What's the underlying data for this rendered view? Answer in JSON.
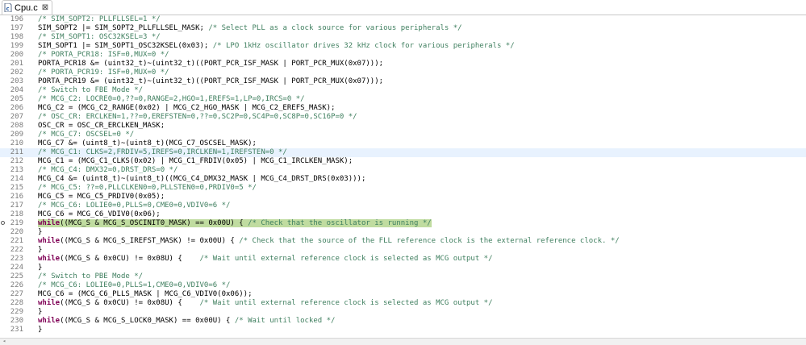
{
  "tab": {
    "title": "Cpu.c",
    "close": "⊠",
    "icon": "c-file-icon"
  },
  "lines": [
    {
      "n": "196",
      "parts": [
        {
          "t": "/* SIM_SOPT2: PLLFLLSEL=1 */",
          "s": "cm"
        }
      ]
    },
    {
      "n": "197",
      "parts": [
        {
          "t": "SIM_SOPT2 |= SIM_SOPT2_PLLFLLSEL_MASK; "
        },
        {
          "t": "/* Select PLL as a clock source for various peripherals */",
          "s": "cm"
        }
      ]
    },
    {
      "n": "198",
      "parts": [
        {
          "t": "/* SIM_SOPT1: OSC32KSEL=3 */",
          "s": "cm"
        }
      ]
    },
    {
      "n": "199",
      "parts": [
        {
          "t": "SIM_SOPT1 |= SIM_SOPT1_OSC32KSEL(0x03); "
        },
        {
          "t": "/* LPO 1kHz oscillator drives 32 kHz clock for various peripherals */",
          "s": "cm"
        }
      ]
    },
    {
      "n": "200",
      "parts": [
        {
          "t": "/* PORTA_PCR18: ISF=0,MUX=0 */",
          "s": "cm"
        }
      ]
    },
    {
      "n": "201",
      "parts": [
        {
          "t": "PORTA_PCR18 &= (uint32_t)~(uint32_t)((PORT_PCR_ISF_MASK | PORT_PCR_MUX(0x07)));"
        }
      ]
    },
    {
      "n": "202",
      "parts": [
        {
          "t": "/* PORTA_PCR19: ISF=0,MUX=0 */",
          "s": "cm"
        }
      ]
    },
    {
      "n": "203",
      "parts": [
        {
          "t": "PORTA_PCR19 &= (uint32_t)~(uint32_t)((PORT_PCR_ISF_MASK | PORT_PCR_MUX(0x07)));"
        }
      ]
    },
    {
      "n": "204",
      "parts": [
        {
          "t": "/* Switch to FBE Mode */",
          "s": "cm"
        }
      ]
    },
    {
      "n": "205",
      "parts": [
        {
          "t": "/* MCG_C2: LOCRE0=0,??=0,RANGE=2,HGO=1,EREFS=1,LP=0,IRCS=0 */",
          "s": "cm"
        }
      ]
    },
    {
      "n": "206",
      "parts": [
        {
          "t": "MCG_C2 = (MCG_C2_RANGE(0x02) | MCG_C2_HGO_MASK | MCG_C2_EREFS_MASK);"
        }
      ]
    },
    {
      "n": "207",
      "parts": [
        {
          "t": "/* OSC_CR: ERCLKEN=1,??=0,EREFSTEN=0,??=0,SC2P=0,SC4P=0,SC8P=0,SC16P=0 */",
          "s": "cm"
        }
      ]
    },
    {
      "n": "208",
      "parts": [
        {
          "t": "OSC_CR = OSC_CR_ERCLKEN_MASK;"
        }
      ]
    },
    {
      "n": "209",
      "parts": [
        {
          "t": "/* MCG_C7: OSCSEL=0 */",
          "s": "cm"
        }
      ]
    },
    {
      "n": "210",
      "parts": [
        {
          "t": "MCG_C7 &= (uint8_t)~(uint8_t)(MCG_C7_OSCSEL_MASK);"
        }
      ]
    },
    {
      "n": "211",
      "current": true,
      "parts": [
        {
          "t": "/* MCG_C1: CLKS=2,FRDIV=5,IREFS=0,IRCLKEN=1,IREFSTEN=0 */",
          "s": "cm"
        }
      ]
    },
    {
      "n": "212",
      "parts": [
        {
          "t": "MCG_C1 = (MCG_C1_CLKS(0x02) | MCG_C1_FRDIV(0x05) | MCG_C1_IRCLKEN_MASK);"
        }
      ]
    },
    {
      "n": "213",
      "parts": [
        {
          "t": "/* MCG_C4: DMX32=0,DRST_DRS=0 */",
          "s": "cm"
        }
      ]
    },
    {
      "n": "214",
      "parts": [
        {
          "t": "MCG_C4 &= (uint8_t)~(uint8_t)((MCG_C4_DMX32_MASK | MCG_C4_DRST_DRS(0x03)));"
        }
      ]
    },
    {
      "n": "215",
      "parts": [
        {
          "t": "/* MCG_C5: ??=0,PLLCLKEN0=0,PLLSTEN0=0,PRDIV0=5 */",
          "s": "cm"
        }
      ]
    },
    {
      "n": "216",
      "parts": [
        {
          "t": "MCG_C5 = MCG_C5_PRDIV0(0x05);"
        }
      ]
    },
    {
      "n": "217",
      "parts": [
        {
          "t": "/* MCG_C6: LOLIE0=0,PLLS=0,CME0=0,VDIV0=6 */",
          "s": "cm"
        }
      ]
    },
    {
      "n": "218",
      "parts": [
        {
          "t": "MCG_C6 = MCG_C6_VDIV0(0x06);"
        }
      ]
    },
    {
      "n": "219",
      "marker": true,
      "highlight": true,
      "parts": [
        {
          "t": "while",
          "s": "kw"
        },
        {
          "t": "((MCG_S & MCG_S_OSCINIT0_MASK) == 0x00U) { "
        },
        {
          "t": "/* Check that the oscillator is running */",
          "s": "cm"
        }
      ]
    },
    {
      "n": "220",
      "parts": [
        {
          "t": "}"
        }
      ]
    },
    {
      "n": "221",
      "parts": [
        {
          "t": "while",
          "s": "kw"
        },
        {
          "t": "((MCG_S & MCG_S_IREFST_MASK) != 0x00U) { "
        },
        {
          "t": "/* Check that the source of the FLL reference clock is the external reference clock. */",
          "s": "cm"
        }
      ]
    },
    {
      "n": "222",
      "parts": [
        {
          "t": "}"
        }
      ]
    },
    {
      "n": "223",
      "parts": [
        {
          "t": "while",
          "s": "kw"
        },
        {
          "t": "((MCG_S & 0x0CU) != 0x08U) {    "
        },
        {
          "t": "/* Wait until external reference clock is selected as MCG output */",
          "s": "cm"
        }
      ]
    },
    {
      "n": "224",
      "parts": [
        {
          "t": "}"
        }
      ]
    },
    {
      "n": "225",
      "parts": [
        {
          "t": "/* Switch to PBE Mode */",
          "s": "cm"
        }
      ]
    },
    {
      "n": "226",
      "parts": [
        {
          "t": "/* MCG_C6: LOLIE0=0,PLLS=1,CME0=0,VDIV0=6 */",
          "s": "cm"
        }
      ]
    },
    {
      "n": "227",
      "parts": [
        {
          "t": "MCG_C6 = (MCG_C6_PLLS_MASK | MCG_C6_VDIV0(0x06));"
        }
      ]
    },
    {
      "n": "228",
      "parts": [
        {
          "t": "while",
          "s": "kw"
        },
        {
          "t": "((MCG_S & 0x0CU) != 0x08U) {    "
        },
        {
          "t": "/* Wait until external reference clock is selected as MCG output */",
          "s": "cm"
        }
      ]
    },
    {
      "n": "229",
      "parts": [
        {
          "t": "}"
        }
      ]
    },
    {
      "n": "230",
      "parts": [
        {
          "t": "while",
          "s": "kw"
        },
        {
          "t": "((MCG_S & MCG_S_LOCK0_MASK) == 0x00U) { "
        },
        {
          "t": "/* Wait until locked */",
          "s": "cm"
        }
      ]
    },
    {
      "n": "231",
      "parts": [
        {
          "t": "}"
        }
      ]
    }
  ],
  "colors": {
    "comment": "#3f7f5f",
    "keyword": "#7f0055",
    "current_line": "#e8f2fe",
    "highlight": "#c0dca0"
  }
}
